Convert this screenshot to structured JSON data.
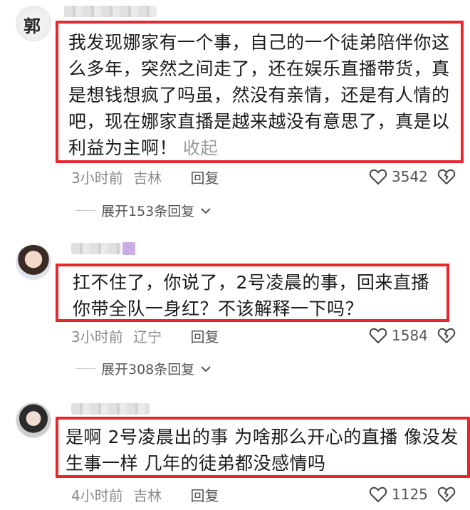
{
  "comments": [
    {
      "text": "我发现娜家有一个事，自己的一个徒弟陪伴你这么多年，突然之间走了，还在娱乐直播带货，真是想钱想疯了吗虽，然没有亲情，还是有人情的吧，现在娜家直播是越来越没有意思了，真是以利益为主啊！",
      "collapse_label": "收起",
      "time": "3小时前",
      "location": "吉林",
      "reply_label": "回复",
      "likes": "3542",
      "expand_label": "展开153条回复",
      "avatar_text": "郭"
    },
    {
      "text": "扛不住了，你说了，2号凌晨的事，回来直播你带全队一身红？不该解释一下吗？",
      "time": "3小时前",
      "location": "辽宁",
      "reply_label": "回复",
      "likes": "1584",
      "expand_label": "展开308条回复"
    },
    {
      "text": "是啊 2号凌晨出的事 为啥那么开心的直播 像没发生事一样 几年的徒弟都没感情吗",
      "time": "4小时前",
      "location": "吉林",
      "reply_label": "回复",
      "likes": "1125"
    }
  ],
  "colors": {
    "highlight_border": "#e8262d",
    "meta_text": "#8a8a8a"
  }
}
